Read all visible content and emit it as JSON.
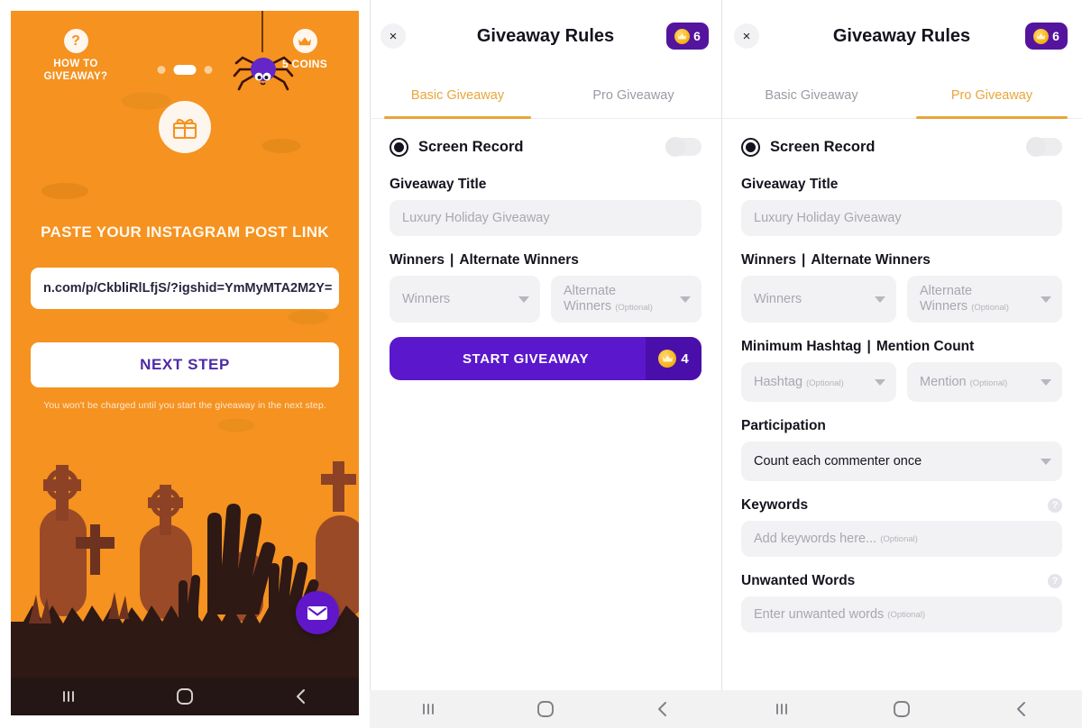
{
  "panel1": {
    "name": "halloween-paste-link-screen",
    "how_to_label": "HOW TO\nGIVEAWAY?",
    "how_to_line1": "HOW TO",
    "how_to_line2": "GIVEAWAY?",
    "coins_label": "5 COINS",
    "help_icon_glyph": "?",
    "crown_icon": "crown-icon",
    "gift_icon": "gift-icon",
    "spider_icon": "spider-icon",
    "paste_heading": "PASTE YOUR INSTAGRAM POST LINK",
    "link_value": "n.com/p/CkbliRlLfjS/?igshid=YmMyMTA2M2Y=",
    "next_step_label": "NEXT STEP",
    "note": "You won't be charged until you start the giveaway in the next step.",
    "fab_icon": "envelope-icon",
    "pager": {
      "total": 3,
      "active_index": 1
    },
    "colors": {
      "background": "#F59220",
      "accent_purple": "#6017c9",
      "button_text": "#4d2aa8",
      "white": "#ffffff"
    }
  },
  "panel2": {
    "name": "giveaway-rules-basic",
    "header": {
      "close_label": "×",
      "title": "Giveaway Rules",
      "coin_count": "6"
    },
    "tabs": [
      {
        "label": "Basic Giveaway",
        "active": true
      },
      {
        "label": "Pro Giveaway",
        "active": false
      }
    ],
    "screen_record": {
      "label": "Screen Record",
      "toggle_on": false
    },
    "giveaway_title": {
      "label": "Giveaway Title",
      "placeholder": "Luxury Holiday Giveaway",
      "value": ""
    },
    "winners_section": {
      "label_left": "Winners",
      "label_sep": "|",
      "label_right": "Alternate Winners",
      "winners_placeholder": "Winners",
      "alternate_line1": "Alternate",
      "alternate_line2": "Winners",
      "alternate_optional": "(Optional)"
    },
    "start_button": {
      "label": "START GIVEAWAY",
      "coin_count": "4"
    }
  },
  "panel3": {
    "name": "giveaway-rules-pro",
    "header": {
      "close_label": "×",
      "title": "Giveaway Rules",
      "coin_count": "6"
    },
    "tabs": [
      {
        "label": "Basic Giveaway",
        "active": false
      },
      {
        "label": "Pro Giveaway",
        "active": true
      }
    ],
    "screen_record": {
      "label": "Screen Record",
      "toggle_on": false
    },
    "giveaway_title": {
      "label": "Giveaway Title",
      "placeholder": "Luxury Holiday Giveaway",
      "value": ""
    },
    "winners_section": {
      "label_left": "Winners",
      "label_sep": "|",
      "label_right": "Alternate Winners",
      "winners_placeholder": "Winners",
      "alternate_line1": "Alternate",
      "alternate_line2": "Winners",
      "alternate_optional": "(Optional)"
    },
    "hashtag_section": {
      "label_left": "Minimum Hashtag",
      "label_sep": "|",
      "label_right": "Mention Count",
      "hashtag_placeholder": "Hashtag",
      "hashtag_optional": "(Optional)",
      "mention_placeholder": "Mention",
      "mention_optional": "(Optional)"
    },
    "participation": {
      "label": "Participation",
      "selected": "Count each commenter once"
    },
    "keywords": {
      "label": "Keywords",
      "placeholder": "Add keywords here...",
      "optional": "(Optional)",
      "help_icon": "question-mark-icon"
    },
    "unwanted_words": {
      "label": "Unwanted Words",
      "placeholder": "Enter unwanted words",
      "optional": "(Optional)",
      "help_icon": "question-mark-icon"
    }
  },
  "navbar": {
    "recents_icon": "recents-icon",
    "home_icon": "home-icon",
    "back_icon": "back-icon"
  }
}
